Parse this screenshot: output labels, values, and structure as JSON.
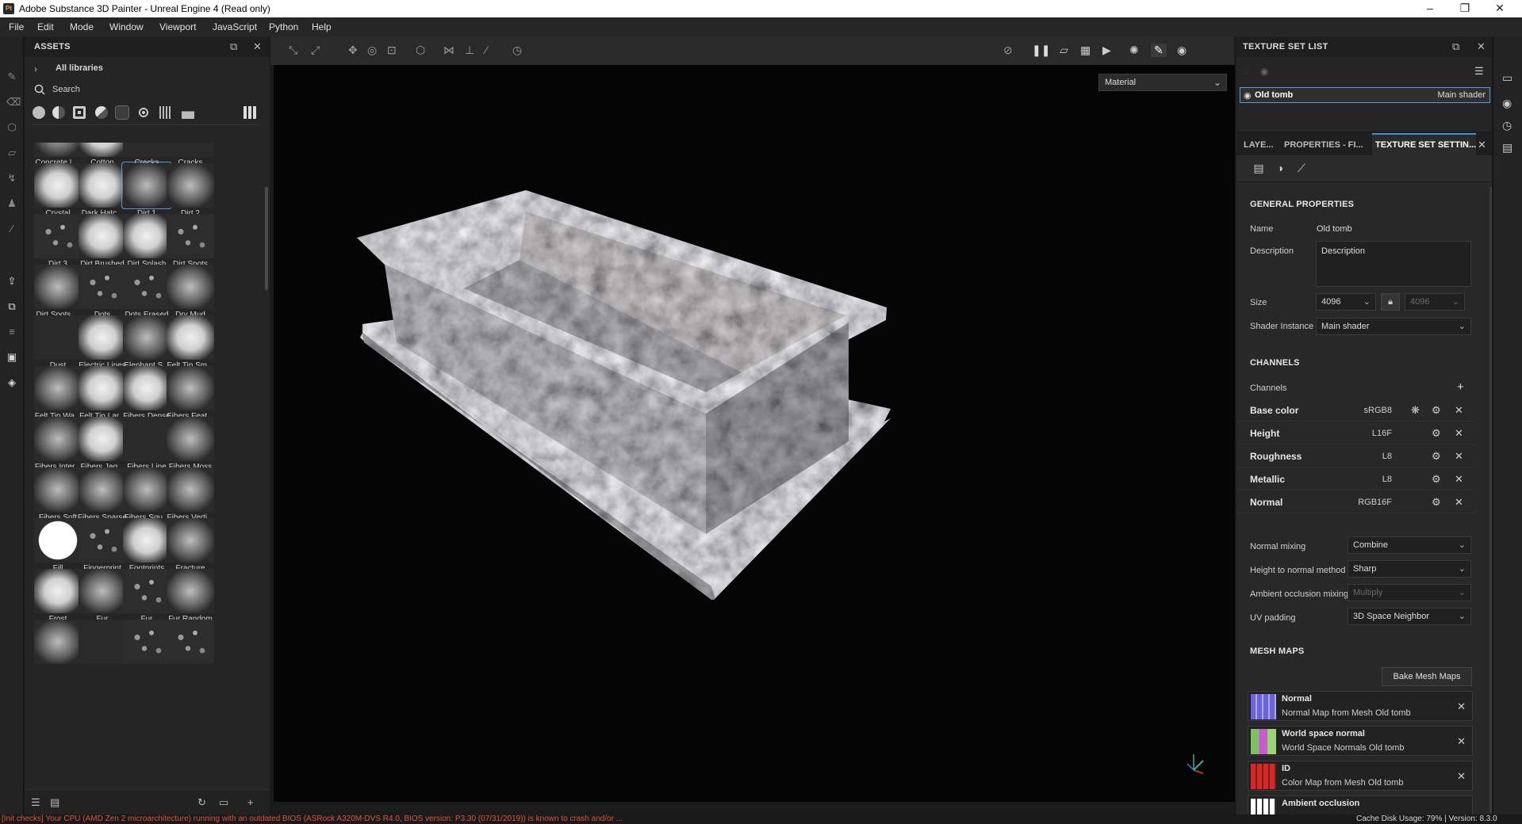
{
  "window": {
    "title": "Adobe Substance 3D Painter - Unreal Engine 4 (Read only)",
    "logo": "Pt"
  },
  "menu": [
    "File",
    "Edit",
    "Mode",
    "Window",
    "Viewport",
    "JavaScript",
    "Python",
    "Help"
  ],
  "assets": {
    "title": "ASSETS",
    "libraries_label": "All libraries",
    "search_placeholder": "Search",
    "items": [
      {
        "label": "Concrete L...",
        "style": "soft"
      },
      {
        "label": "Cotton",
        "style": "bright"
      },
      {
        "label": "Cracks",
        "style": "dark"
      },
      {
        "label": "Cracks",
        "style": "dark"
      },
      {
        "label": "Crystal",
        "style": "bright"
      },
      {
        "label": "Dark Hatc...",
        "style": "bright"
      },
      {
        "label": "Dirt 1",
        "style": "soft",
        "selected": true
      },
      {
        "label": "Dirt 2",
        "style": "soft"
      },
      {
        "label": "Dirt 3",
        "style": "speck"
      },
      {
        "label": "Dirt Brushed",
        "style": "bright"
      },
      {
        "label": "Dirt Splash",
        "style": "bright"
      },
      {
        "label": "Dirt Spots",
        "style": "speck"
      },
      {
        "label": "Dirt Spots ...",
        "style": "soft"
      },
      {
        "label": "Dots",
        "style": "speck"
      },
      {
        "label": "Dots Erased",
        "style": "speck"
      },
      {
        "label": "Dry Mud",
        "style": "soft"
      },
      {
        "label": "Dust",
        "style": "dark"
      },
      {
        "label": "Electric Lines",
        "style": "bright"
      },
      {
        "label": "Elephant S...",
        "style": "soft"
      },
      {
        "label": "Felt Tip Sm...",
        "style": "bright"
      },
      {
        "label": "Felt Tip Wa...",
        "style": "soft"
      },
      {
        "label": "Felt Tip Lar...",
        "style": "bright"
      },
      {
        "label": "Fibers Dense",
        "style": "bright"
      },
      {
        "label": "Fibers Feat...",
        "style": "soft"
      },
      {
        "label": "Fibers Inter...",
        "style": "soft"
      },
      {
        "label": "Fibers Jag...",
        "style": "bright"
      },
      {
        "label": "Fibers Line",
        "style": "dark"
      },
      {
        "label": "Fibers Moss",
        "style": "soft"
      },
      {
        "label": "Fibers Soft",
        "style": "soft"
      },
      {
        "label": "Fibers Sparse",
        "style": "soft"
      },
      {
        "label": "Fibers Squ...",
        "style": "soft"
      },
      {
        "label": "Fibers Verti...",
        "style": "soft"
      },
      {
        "label": "Fill",
        "style": "fill"
      },
      {
        "label": "Fingerprint",
        "style": "speck"
      },
      {
        "label": "Footprints",
        "style": "bright"
      },
      {
        "label": "Fracture",
        "style": "soft"
      },
      {
        "label": "Frost",
        "style": "bright"
      },
      {
        "label": "Fur",
        "style": "soft"
      },
      {
        "label": "Fur",
        "style": "speck"
      },
      {
        "label": "Fur Random",
        "style": "soft"
      },
      {
        "label": "",
        "style": "soft"
      },
      {
        "label": "",
        "style": "dark"
      },
      {
        "label": "",
        "style": "speck"
      },
      {
        "label": "",
        "style": "speck"
      }
    ]
  },
  "viewport": {
    "material_mode": "Material"
  },
  "texture_set_list": {
    "title": "TEXTURE SET LIST",
    "row_name": "Old tomb",
    "row_shader": "Main shader"
  },
  "tabs": {
    "layers": "LAYE...",
    "properties": "PROPERTIES - FI...",
    "texture_set_settings": "TEXTURE SET SETTIN..."
  },
  "general": {
    "header": "GENERAL PROPERTIES",
    "name_label": "Name",
    "name_value": "Old tomb",
    "description_label": "Description",
    "description_value": "Description",
    "size_label": "Size",
    "size_value": "4096",
    "size_value_locked": "4096",
    "shader_label": "Shader Instance",
    "shader_value": "Main shader"
  },
  "channels": {
    "header": "CHANNELS",
    "label": "Channels",
    "rows": [
      {
        "name": "Base color",
        "format": "sRGB8"
      },
      {
        "name": "Height",
        "format": "L16F"
      },
      {
        "name": "Roughness",
        "format": "L8"
      },
      {
        "name": "Metallic",
        "format": "L8"
      },
      {
        "name": "Normal",
        "format": "RGB16F"
      }
    ]
  },
  "mixing": {
    "normal_mixing_label": "Normal mixing",
    "normal_mixing_value": "Combine",
    "h2n_label": "Height to normal method",
    "h2n_value": "Sharp",
    "ao_label": "Ambient occlusion mixing",
    "ao_value": "Multiply",
    "uv_label": "UV padding",
    "uv_value": "3D Space Neighbor"
  },
  "mesh_maps": {
    "header": "MESH MAPS",
    "bake_button": "Bake Mesh Maps",
    "items": [
      {
        "title": "Normal",
        "sub": "Normal Map from Mesh Old tomb",
        "color": "#6b63d6"
      },
      {
        "title": "World space normal",
        "sub": "World Space Normals Old tomb",
        "color": "#7fbf6a"
      },
      {
        "title": "ID",
        "sub": "Color Map from Mesh Old tomb",
        "color": "#d12a2a"
      },
      {
        "title": "Ambient occlusion",
        "sub": "",
        "color": "#ffffff"
      }
    ]
  },
  "status": {
    "error": "[Init checks] Your CPU (AMD Zen 2 microarchitecture) running with an outdated BIOS (ASRock A320M-DVS R4.0, BIOS version: P3.30 (07/31/2019)) is known to crash and/or ...",
    "cache": "Cache Disk Usage:   79% | Version: 8.3.0"
  }
}
